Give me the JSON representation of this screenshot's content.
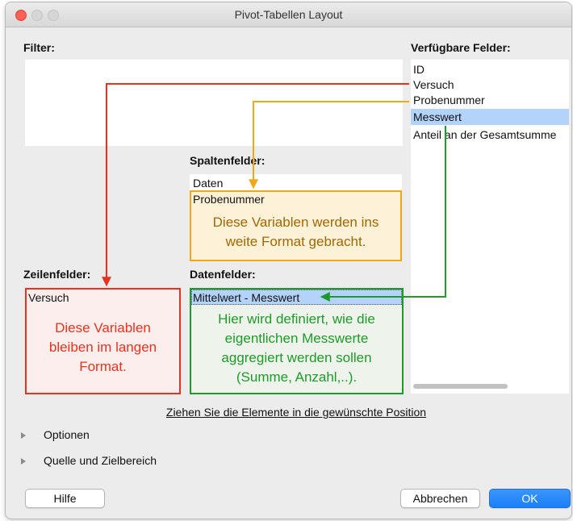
{
  "window": {
    "title": "Pivot-Tabellen Layout"
  },
  "labels": {
    "filter": "Filter:",
    "available_fields": "Verfügbare Felder:",
    "column_fields": "Spaltenfelder:",
    "row_fields": "Zeilenfelder:",
    "data_fields": "Datenfelder:"
  },
  "available_fields": [
    "ID",
    "Versuch",
    "Probenummer",
    "Messwert",
    "Anteil an der Gesamtsumme"
  ],
  "selected_available_field": "Messwert",
  "column_fields": [
    "Daten",
    "Probenummer"
  ],
  "row_fields": [
    "Versuch"
  ],
  "data_fields": [
    "Mittelwert - Messwert"
  ],
  "annotations": {
    "column_note": "Diese Variablen werden ins weite Format gebracht.",
    "row_note": "Diese Variablen bleiben im langen Format.",
    "data_note": "Hier wird definiert, wie die eigentlichen Messwerte aggregiert werden sollen (Summe, Anzahl,..)."
  },
  "hint": "Ziehen Sie die Elemente in die gewünschte Position",
  "expanders": {
    "options": "Optionen",
    "source": "Quelle und Zielbereich"
  },
  "buttons": {
    "help": "Hilfe",
    "cancel": "Abbrechen",
    "ok": "OK"
  },
  "colors": {
    "row_note": "#e8321e",
    "column_note": "#f0a818",
    "data_note": "#1f9a2a",
    "accent": "#1a82fb",
    "selection": "#b3d3fb"
  }
}
